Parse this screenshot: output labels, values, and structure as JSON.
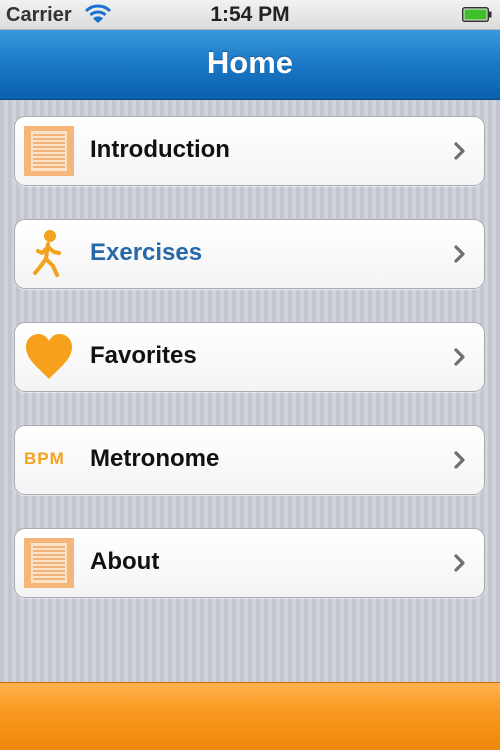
{
  "status_bar": {
    "carrier": "Carrier",
    "time": "1:54 PM",
    "wifi_icon": "wifi-icon",
    "battery_icon": "battery-full-icon"
  },
  "nav": {
    "title": "Home"
  },
  "menu": {
    "items": [
      {
        "label": "Introduction",
        "icon": "document-icon",
        "active": false
      },
      {
        "label": "Exercises",
        "icon": "walking-person-icon",
        "active": true
      },
      {
        "label": "Favorites",
        "icon": "heart-icon",
        "active": false
      },
      {
        "label": "Metronome",
        "icon": "bpm-icon",
        "icon_text": "BPM",
        "active": false
      },
      {
        "label": "About",
        "icon": "document-icon",
        "active": false
      }
    ]
  },
  "colors": {
    "nav_blue": "#1a78c6",
    "accent_orange": "#f3a21c",
    "active_text": "#2668a8",
    "bottom_orange": "#f89a20"
  }
}
